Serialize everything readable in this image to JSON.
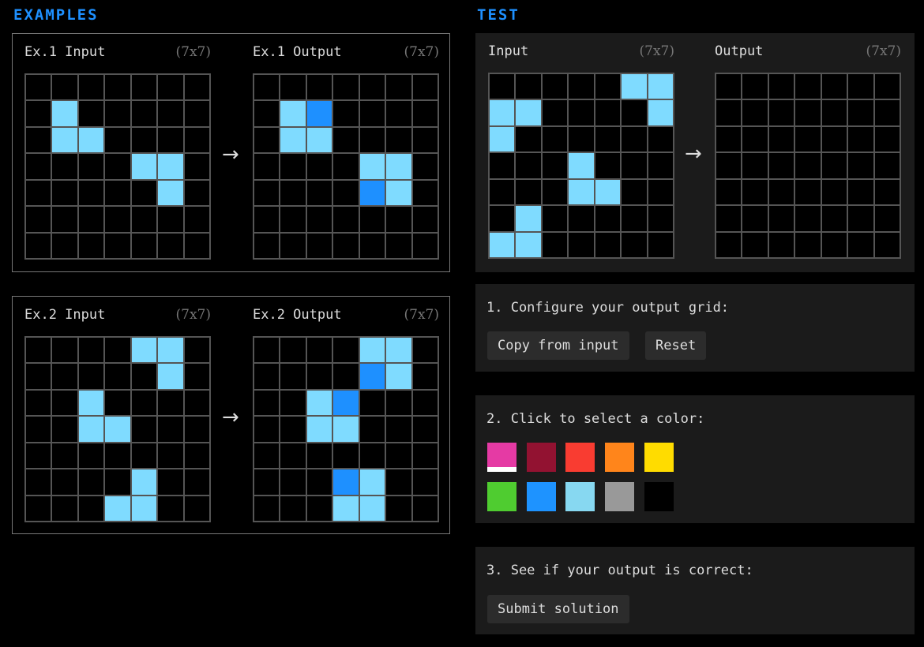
{
  "examples_title": "EXAMPLES",
  "test_title": "TEST",
  "arrow": "→",
  "palette": {
    "0": "#000000",
    "1": "#1e90ff",
    "2": "#ff4136",
    "3": "#2ecc40",
    "4": "#ffdc00",
    "5": "#aaaaaa",
    "6": "#f012be",
    "7": "#ff851b",
    "8": "#7fdbff",
    "9": "#870c25"
  },
  "examples": [
    {
      "input_label": "Ex.1 Input",
      "input_dims": "(7x7)",
      "output_label": "Ex.1 Output",
      "output_dims": "(7x7)",
      "input": [
        [
          0,
          0,
          0,
          0,
          0,
          0,
          0
        ],
        [
          0,
          8,
          0,
          0,
          0,
          0,
          0
        ],
        [
          0,
          8,
          8,
          0,
          0,
          0,
          0
        ],
        [
          0,
          0,
          0,
          0,
          8,
          8,
          0
        ],
        [
          0,
          0,
          0,
          0,
          0,
          8,
          0
        ],
        [
          0,
          0,
          0,
          0,
          0,
          0,
          0
        ],
        [
          0,
          0,
          0,
          0,
          0,
          0,
          0
        ]
      ],
      "output": [
        [
          0,
          0,
          0,
          0,
          0,
          0,
          0
        ],
        [
          0,
          8,
          1,
          0,
          0,
          0,
          0
        ],
        [
          0,
          8,
          8,
          0,
          0,
          0,
          0
        ],
        [
          0,
          0,
          0,
          0,
          8,
          8,
          0
        ],
        [
          0,
          0,
          0,
          0,
          1,
          8,
          0
        ],
        [
          0,
          0,
          0,
          0,
          0,
          0,
          0
        ],
        [
          0,
          0,
          0,
          0,
          0,
          0,
          0
        ]
      ]
    },
    {
      "input_label": "Ex.2 Input",
      "input_dims": "(7x7)",
      "output_label": "Ex.2 Output",
      "output_dims": "(7x7)",
      "input": [
        [
          0,
          0,
          0,
          0,
          8,
          8,
          0
        ],
        [
          0,
          0,
          0,
          0,
          0,
          8,
          0
        ],
        [
          0,
          0,
          8,
          0,
          0,
          0,
          0
        ],
        [
          0,
          0,
          8,
          8,
          0,
          0,
          0
        ],
        [
          0,
          0,
          0,
          0,
          0,
          0,
          0
        ],
        [
          0,
          0,
          0,
          0,
          8,
          0,
          0
        ],
        [
          0,
          0,
          0,
          8,
          8,
          0,
          0
        ]
      ],
      "output": [
        [
          0,
          0,
          0,
          0,
          8,
          8,
          0
        ],
        [
          0,
          0,
          0,
          0,
          1,
          8,
          0
        ],
        [
          0,
          0,
          8,
          1,
          0,
          0,
          0
        ],
        [
          0,
          0,
          8,
          8,
          0,
          0,
          0
        ],
        [
          0,
          0,
          0,
          0,
          0,
          0,
          0
        ],
        [
          0,
          0,
          0,
          1,
          8,
          0,
          0
        ],
        [
          0,
          0,
          0,
          8,
          8,
          0,
          0
        ]
      ]
    }
  ],
  "test": {
    "input_label": "Input",
    "input_dims": "(7x7)",
    "output_label": "Output",
    "output_dims": "(7x7)",
    "input": [
      [
        0,
        0,
        0,
        0,
        0,
        8,
        8
      ],
      [
        8,
        8,
        0,
        0,
        0,
        0,
        8
      ],
      [
        8,
        0,
        0,
        0,
        0,
        0,
        0
      ],
      [
        0,
        0,
        0,
        8,
        0,
        0,
        0
      ],
      [
        0,
        0,
        0,
        8,
        8,
        0,
        0
      ],
      [
        0,
        8,
        0,
        0,
        0,
        0,
        0
      ],
      [
        8,
        8,
        0,
        0,
        0,
        0,
        0
      ]
    ],
    "output": [
      [
        0,
        0,
        0,
        0,
        0,
        0,
        0
      ],
      [
        0,
        0,
        0,
        0,
        0,
        0,
        0
      ],
      [
        0,
        0,
        0,
        0,
        0,
        0,
        0
      ],
      [
        0,
        0,
        0,
        0,
        0,
        0,
        0
      ],
      [
        0,
        0,
        0,
        0,
        0,
        0,
        0
      ],
      [
        0,
        0,
        0,
        0,
        0,
        0,
        0
      ],
      [
        0,
        0,
        0,
        0,
        0,
        0,
        0
      ]
    ]
  },
  "step1": {
    "text": "1. Configure your output grid:",
    "copy_label": "Copy from input",
    "reset_label": "Reset"
  },
  "step2": {
    "text": "2. Click to select a color:",
    "colors": [
      "#e53aa4",
      "#921231",
      "#f93c31",
      "#ff851b",
      "#ffdc00",
      "#4fcc30",
      "#1e93ff",
      "#87d8f1",
      "#999999",
      "#000000"
    ],
    "selected_index": 0
  },
  "step3": {
    "text": "3. See if your output is correct:",
    "submit_label": "Submit solution"
  }
}
